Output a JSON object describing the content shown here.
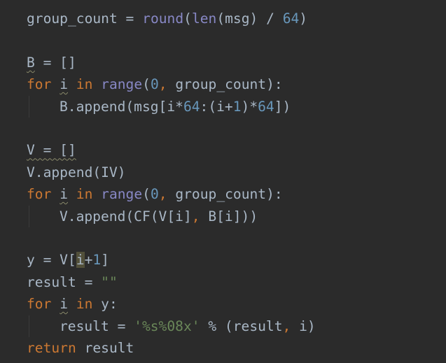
{
  "editor": {
    "lines": [
      {
        "indent": 0,
        "tokens": [
          {
            "t": "group_count = ",
            "c": "default"
          },
          {
            "t": "round",
            "c": "builtin"
          },
          {
            "t": "(",
            "c": "default"
          },
          {
            "t": "len",
            "c": "builtin"
          },
          {
            "t": "(msg) / ",
            "c": "default"
          },
          {
            "t": "64",
            "c": "number"
          },
          {
            "t": ")",
            "c": "default"
          }
        ]
      },
      {
        "indent": 0,
        "tokens": []
      },
      {
        "indent": 0,
        "tokens": [
          {
            "t": "B",
            "c": "default",
            "wavy": true
          },
          {
            "t": " = []",
            "c": "default"
          }
        ]
      },
      {
        "indent": 0,
        "tokens": [
          {
            "t": "for ",
            "c": "keyword"
          },
          {
            "t": "i",
            "c": "default",
            "wavy": true
          },
          {
            "t": " in ",
            "c": "keyword"
          },
          {
            "t": "range",
            "c": "builtin"
          },
          {
            "t": "(",
            "c": "default"
          },
          {
            "t": "0",
            "c": "number"
          },
          {
            "t": ", ",
            "c": "punct"
          },
          {
            "t": "group_count):",
            "c": "default"
          }
        ]
      },
      {
        "indent": 1,
        "tokens": [
          {
            "t": "B.append(msg[i*",
            "c": "default"
          },
          {
            "t": "64",
            "c": "number"
          },
          {
            "t": ":(i+",
            "c": "default"
          },
          {
            "t": "1",
            "c": "number"
          },
          {
            "t": ")*",
            "c": "default"
          },
          {
            "t": "64",
            "c": "number"
          },
          {
            "t": "])",
            "c": "default"
          }
        ]
      },
      {
        "indent": 0,
        "tokens": []
      },
      {
        "indent": 0,
        "tokens": [
          {
            "t": "V = []",
            "c": "default",
            "wavy": true
          }
        ]
      },
      {
        "indent": 0,
        "tokens": [
          {
            "t": "V.append(IV)",
            "c": "default"
          }
        ]
      },
      {
        "indent": 0,
        "tokens": [
          {
            "t": "for ",
            "c": "keyword"
          },
          {
            "t": "i",
            "c": "default",
            "wavy": true
          },
          {
            "t": " in ",
            "c": "keyword"
          },
          {
            "t": "range",
            "c": "builtin"
          },
          {
            "t": "(",
            "c": "default"
          },
          {
            "t": "0",
            "c": "number"
          },
          {
            "t": ", ",
            "c": "punct"
          },
          {
            "t": "group_count):",
            "c": "default"
          }
        ]
      },
      {
        "indent": 1,
        "tokens": [
          {
            "t": "V.append(CF(V[i]",
            "c": "default"
          },
          {
            "t": ", ",
            "c": "punct"
          },
          {
            "t": "B[i]))",
            "c": "default"
          }
        ]
      },
      {
        "indent": 0,
        "tokens": []
      },
      {
        "indent": 0,
        "tokens": [
          {
            "t": "y = V[",
            "c": "default"
          },
          {
            "t": "i",
            "c": "default",
            "hl": true
          },
          {
            "t": "+",
            "c": "default"
          },
          {
            "t": "1",
            "c": "number"
          },
          {
            "t": "]",
            "c": "default"
          }
        ]
      },
      {
        "indent": 0,
        "tokens": [
          {
            "t": "result = ",
            "c": "default"
          },
          {
            "t": "\"\"",
            "c": "string"
          }
        ]
      },
      {
        "indent": 0,
        "tokens": [
          {
            "t": "for ",
            "c": "keyword"
          },
          {
            "t": "i",
            "c": "default",
            "wavy": true
          },
          {
            "t": " in ",
            "c": "keyword"
          },
          {
            "t": "y:",
            "c": "default"
          }
        ]
      },
      {
        "indent": 1,
        "tokens": [
          {
            "t": "result = ",
            "c": "default"
          },
          {
            "t": "'%s%08x'",
            "c": "string"
          },
          {
            "t": " % (result",
            "c": "default"
          },
          {
            "t": ", ",
            "c": "punct"
          },
          {
            "t": "i)",
            "c": "default"
          }
        ]
      },
      {
        "indent": 0,
        "tokens": [
          {
            "t": "return ",
            "c": "keyword"
          },
          {
            "t": "result",
            "c": "default"
          }
        ]
      }
    ],
    "colors": {
      "background": "#2b2b2b",
      "default": "#a9b7c6",
      "keyword": "#cc7832",
      "builtin": "#8888c6",
      "number": "#6897bb",
      "string": "#6a8759",
      "caret_highlight": "#52503a"
    }
  }
}
